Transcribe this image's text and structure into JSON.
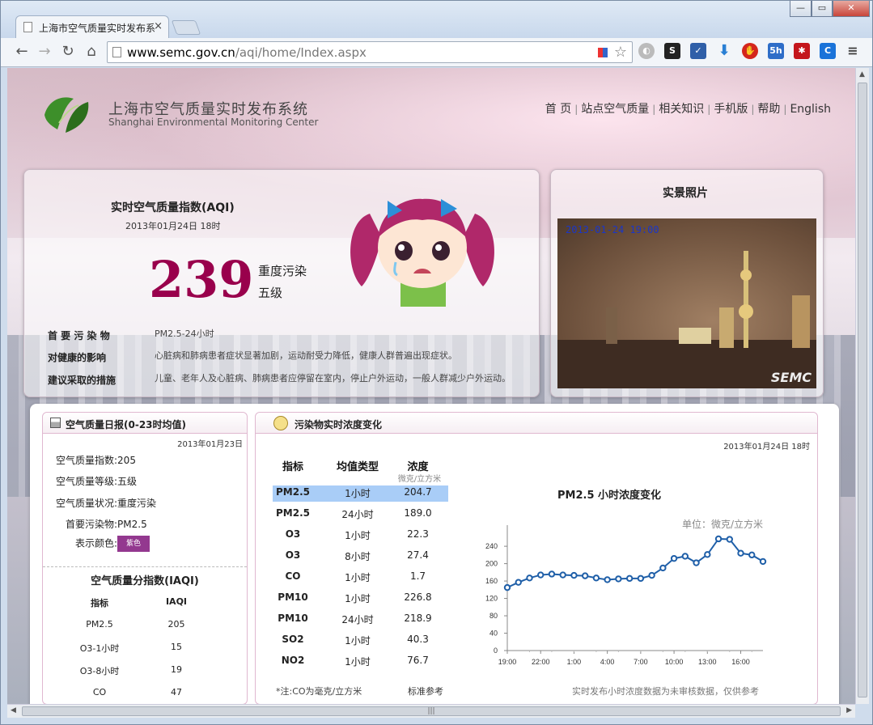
{
  "browser": {
    "tab_title": "上海市空气质量实时发布系",
    "url_host": "www.semc.gov.cn",
    "url_path": "/aqi/home/Index.aspx"
  },
  "site": {
    "name_cn": "上海市空气质量实时发布系统",
    "name_en": "Shanghai Environmental Monitoring Center",
    "nav": [
      "首 页",
      "站点空气质量",
      "相关知识",
      "手机版",
      "帮助",
      "English"
    ]
  },
  "aqi": {
    "title": "实时空气质量指数(AQI)",
    "date": "2013年01月24日 18时",
    "value": "239",
    "category": "重度污染",
    "level": "五级",
    "rows": [
      {
        "key": "首 要 污 染 物",
        "value": "PM2.5-24小时"
      },
      {
        "key": "对健康的影响",
        "value": "心脏病和肺病患者症状显著加剧，运动耐受力降低，健康人群普遍出现症状。"
      },
      {
        "key": "建议采取的措施",
        "value": "儿童、老年人及心脏病、肺病患者应停留在室内，停止户外运动，一般人群减少户外运动。"
      }
    ]
  },
  "photo": {
    "title": "实景照片",
    "timestamp": "2013-01-24 19:00",
    "watermark": "SEMC"
  },
  "daily": {
    "title": "空气质量日报(0-23时均值)",
    "date": "2013年01月23日",
    "aqi_label": "空气质量指数:",
    "aqi_value": "205",
    "level_label": "空气质量等级:",
    "level_value": "五级",
    "status_label": "空气质量状况:",
    "status_value": "重度污染",
    "primary_label": "首要污染物:",
    "primary_value": "PM2.5",
    "color_label": "表示颜色:",
    "color_value": "紫色",
    "color_hex": "#93388f",
    "iaqi_title": "空气质量分指数(IAQI)",
    "iaqi_h1": "指标",
    "iaqi_h2": "IAQI",
    "iaqi_rows": [
      {
        "name": "PM2.5",
        "value": "205"
      },
      {
        "name": "O3-1小时",
        "value": "15"
      },
      {
        "name": "O3-8小时",
        "value": "19"
      },
      {
        "name": "CO",
        "value": "47"
      }
    ]
  },
  "realtime": {
    "title": "污染物实时浓度变化",
    "date": "2013年01月24日 18时",
    "headers": {
      "indicator": "指标",
      "avg_type": "均值类型",
      "conc": "浓度",
      "unit": "微克/立方米"
    },
    "rows": [
      {
        "name": "PM2.5",
        "type": "1小时",
        "value": "204.7"
      },
      {
        "name": "PM2.5",
        "type": "24小时",
        "value": "189.0"
      },
      {
        "name": "O3",
        "type": "1小时",
        "value": "22.3"
      },
      {
        "name": "O3",
        "type": "8小时",
        "value": "27.4"
      },
      {
        "name": "CO",
        "type": "1小时",
        "value": "1.7"
      },
      {
        "name": "PM10",
        "type": "1小时",
        "value": "226.8"
      },
      {
        "name": "PM10",
        "type": "24小时",
        "value": "218.9"
      },
      {
        "name": "SO2",
        "type": "1小时",
        "value": "40.3"
      },
      {
        "name": "NO2",
        "type": "1小时",
        "value": "76.7"
      }
    ],
    "note": "*注:CO为毫克/立方米",
    "std_link": "标准参考",
    "disclaimer": "实时发布小时浓度数据为未审核数据，仅供参考"
  },
  "chart_data": {
    "type": "line",
    "title": "PM2.5 小时浓度变化",
    "unit_label": "单位：微克/立方米",
    "x_ticks": [
      "19:00",
      "22:00",
      "1:00",
      "4:00",
      "7:00",
      "10:00",
      "13:00",
      "16:00"
    ],
    "y_ticks": [
      0,
      40,
      80,
      120,
      160,
      200,
      240
    ],
    "ylim": [
      0,
      270
    ],
    "color": "#1f5fa8",
    "x": [
      "19:00",
      "20:00",
      "21:00",
      "22:00",
      "23:00",
      "0:00",
      "1:00",
      "2:00",
      "3:00",
      "4:00",
      "5:00",
      "6:00",
      "7:00",
      "8:00",
      "9:00",
      "10:00",
      "11:00",
      "12:00",
      "13:00",
      "14:00",
      "15:00",
      "16:00",
      "17:00",
      "18:00"
    ],
    "values": [
      145,
      157,
      167,
      174,
      176,
      174,
      173,
      172,
      167,
      163,
      165,
      166,
      166,
      173,
      190,
      212,
      217,
      202,
      221,
      257,
      256,
      224,
      220,
      205
    ]
  }
}
